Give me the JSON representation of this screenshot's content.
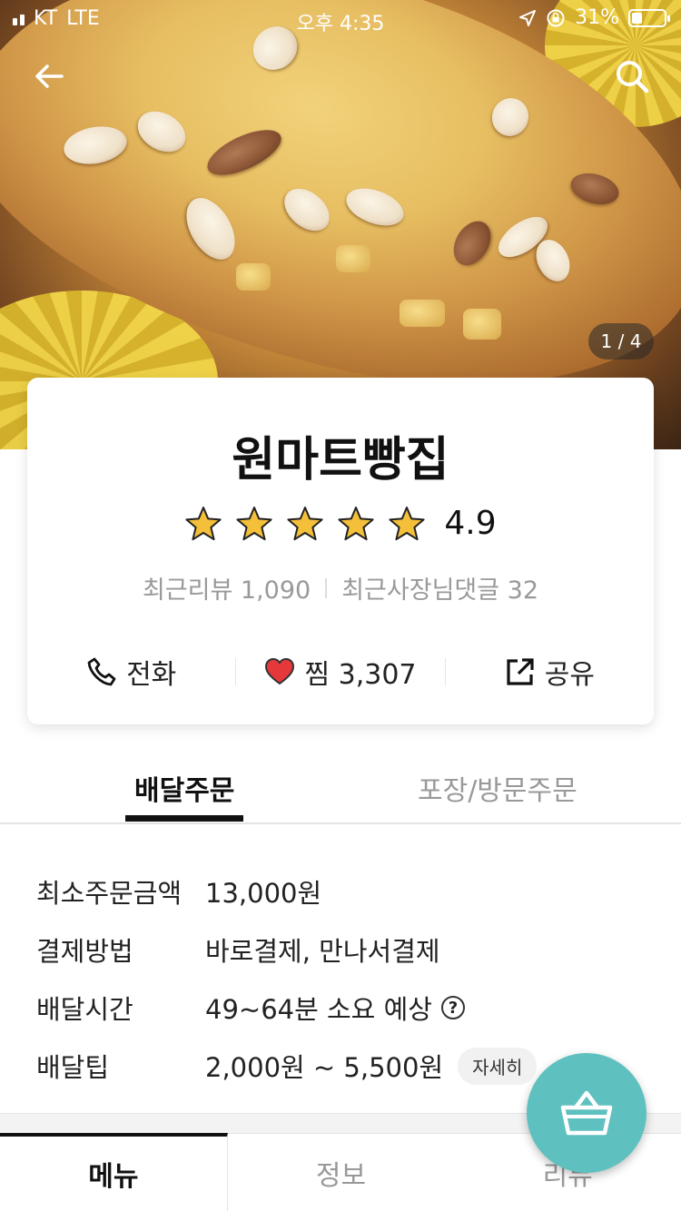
{
  "status_bar": {
    "carrier": "KT",
    "network": "LTE",
    "time": "오후 4:35",
    "battery": "31%",
    "battery_level": 0.31
  },
  "hero": {
    "image_counter": "1 / 4"
  },
  "icons": {
    "back": "back-arrow-icon",
    "search": "search-icon",
    "star": "star-icon",
    "phone": "phone-icon",
    "heart": "heart-icon",
    "share": "share-icon",
    "help": "question-icon",
    "cart": "cart-basket-icon"
  },
  "colors": {
    "star": "#f4c03a",
    "heart": "#e5383b",
    "cart_fab": "#5fc1bf",
    "active_tab": "#111111",
    "inactive_text": "#999999"
  },
  "store": {
    "name": "원마트빵집",
    "rating": "4.9",
    "stars": 5,
    "recent_reviews": "최근리뷰 1,090",
    "owner_replies": "최근사장님댓글 32"
  },
  "actions": {
    "call": "전화",
    "like": "찜 3,307",
    "share": "공유"
  },
  "order_tabs": {
    "delivery": "배달주문",
    "pickup": "포장/방문주문"
  },
  "info": {
    "rows": [
      {
        "label": "최소주문금액",
        "value": "13,000원"
      },
      {
        "label": "결제방법",
        "value": "바로결제, 만나서결제"
      },
      {
        "label": "배달시간",
        "value": "49~64분 소요 예상",
        "help": "?"
      },
      {
        "label": "배달팁",
        "value": "2,000원 ~ 5,500원",
        "button": "자세히"
      }
    ]
  },
  "bottom_tabs": {
    "menu": "메뉴",
    "info": "정보",
    "review": "리뷰"
  }
}
